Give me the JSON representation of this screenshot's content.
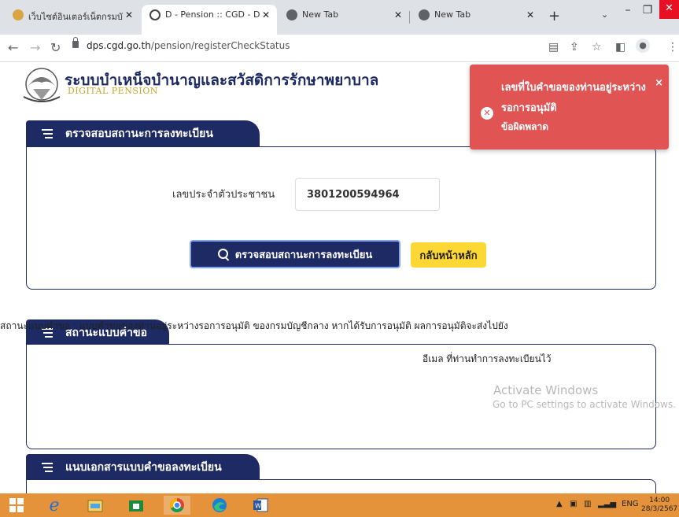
{
  "browser": {
    "tabs": [
      {
        "title": "เว็บไซต์อินเตอร์เน็ตกรมบัญชีกลาง",
        "active": false
      },
      {
        "title": "D - Pension :: CGD - D - Pension",
        "active": true
      },
      {
        "title": "New Tab",
        "active": false
      },
      {
        "title": "New Tab",
        "active": false
      }
    ],
    "url_domain": "dps.cgd.go.th",
    "url_path": "/pension/registerCheckStatus"
  },
  "header": {
    "title": "ระบบบำเหน็จบำนาญและสวัสดิการรักษาพยาบาล",
    "subtitle": "DIGITAL PENSION"
  },
  "check_section": {
    "heading": "ตรวจสอบสถานะการลงทะเบียน",
    "id_label": "เลขประจำตัวประชาชน",
    "id_value": "3801200594964",
    "check_button": "ตรวจสอบสถานะการลงทะเบียน",
    "home_button": "กลับหน้าหลัก"
  },
  "status_section": {
    "heading": "สถานะแบบคำขอ",
    "line1": "สถานะแบบคำขอ : แบบคำขอของท่านอยู่ระหว่างรอการอนุมัติ ของกรมบัญชีกลาง หากได้รับการอนุมัติ ผลการอนุมัติจะส่งไปยัง",
    "line2": "อีเมล ที่ท่านทำการลงทะเบียนไว้"
  },
  "docs_section": {
    "heading": "แนบเอกสารแบบคำขอลงทะเบียน"
  },
  "toast": {
    "line1": "เลขที่ใบคำขอของท่านอยู่ระหว่าง",
    "line2": "รอการอนุมัติ",
    "line3": "ข้อผิดพลาด",
    "close": "×",
    "color": "#e05454"
  },
  "watermark": {
    "line1": "Activate Windows",
    "line2": "Go to PC settings to activate Windows."
  },
  "taskbar": {
    "lang": "ENG",
    "time": "14:00",
    "date": "28/3/2567"
  },
  "colors": {
    "navy": "#1d2a63",
    "yellow": "#fdd835",
    "taskbar": "#e4933a"
  }
}
